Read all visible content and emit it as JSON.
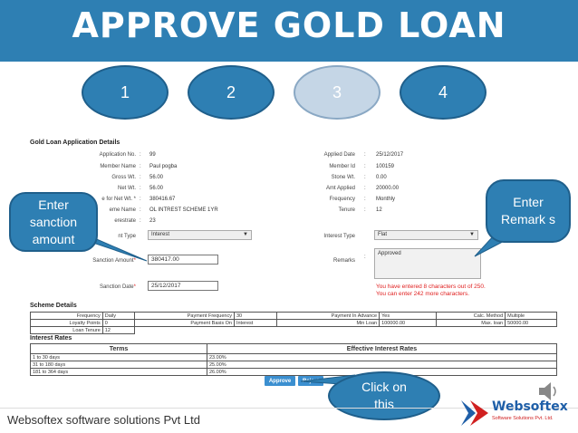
{
  "title": "APPROVE GOLD LOAN",
  "steps": [
    "1",
    "2",
    "3",
    "4"
  ],
  "form": {
    "heading": "Gold Loan Application Details",
    "left_fields": [
      {
        "label": "Application No.",
        "value": "99"
      },
      {
        "label": "Member Name",
        "value": "Paul pogba"
      },
      {
        "label": "Gross Wt.",
        "value": "56.00"
      },
      {
        "label": "Net Wt.",
        "value": "56.00"
      },
      {
        "label": "e for Net Wt. *",
        "value": "380416.67"
      },
      {
        "label": "eme Name",
        "value": "OL INTREST SCHEME 1YR"
      },
      {
        "label": "erestrate",
        "value": "23"
      }
    ],
    "right_fields": [
      {
        "label": "Applied Date",
        "value": "25/12/2017"
      },
      {
        "label": "Member Id",
        "value": "100159"
      },
      {
        "label": "Stone Wt.",
        "value": "0.00"
      },
      {
        "label": "Amt Applied",
        "value": "20000.00"
      },
      {
        "label": "Frequency",
        "value": "Monthly"
      },
      {
        "label": "Tenure",
        "value": "12"
      }
    ],
    "interest_type_left_label": "nt Type",
    "interest_type_left_value": "Interest",
    "interest_type_right_label": "Interest Type",
    "interest_type_right_value": "Flat",
    "sanction_amount_label": "Sanction Amount",
    "sanction_amount_value": "380417.00",
    "remarks_label": "Remarks",
    "remarks_value": "Approved",
    "sanction_date_label": "Sanction Date",
    "sanction_date_value": "25/12/2017",
    "warning_line1": "You have entered 8 characters out of 250.",
    "warning_line2": "You can enter 242 more characters."
  },
  "scheme": {
    "heading": "Scheme Details",
    "rows": [
      [
        "Frequency",
        "Daily",
        "Payment Frequency",
        "30",
        "Payment In Advance",
        "Yes",
        "Calc. Method",
        "Multiple"
      ],
      [
        "Loyalty Points",
        "0",
        "Payment Basis On",
        "Interest",
        "Min Loan",
        "100000.00",
        "Max. loan",
        "50000.00"
      ],
      [
        "Loan Tenure",
        "12",
        "",
        "",
        "",
        "",
        "",
        ""
      ]
    ]
  },
  "rates": {
    "heading": "Interest Rates",
    "col_terms": "Terms",
    "col_effective": "Effective Interest Rates",
    "rows": [
      [
        "1 to 30 days",
        "23.00%"
      ],
      [
        "31 to 180 days",
        "25.00%"
      ],
      [
        "181 to 364 days",
        "26.00%"
      ]
    ]
  },
  "buttons": {
    "approve": "Approve",
    "reject": "Reject"
  },
  "callouts": {
    "sanction": "Enter sanction amount",
    "remarks": "Enter Remark s",
    "click": "Click on this"
  },
  "footer": {
    "company": "Websoftex software solutions Pvt Ltd",
    "logo_name": "Websoftex",
    "logo_sub": "Software Solutions Pvt. Ltd."
  },
  "colors": {
    "banner": "#2e7fb3",
    "step_active": "#c5d6e6",
    "warning": "#e02020",
    "button": "#3b8fd0"
  }
}
